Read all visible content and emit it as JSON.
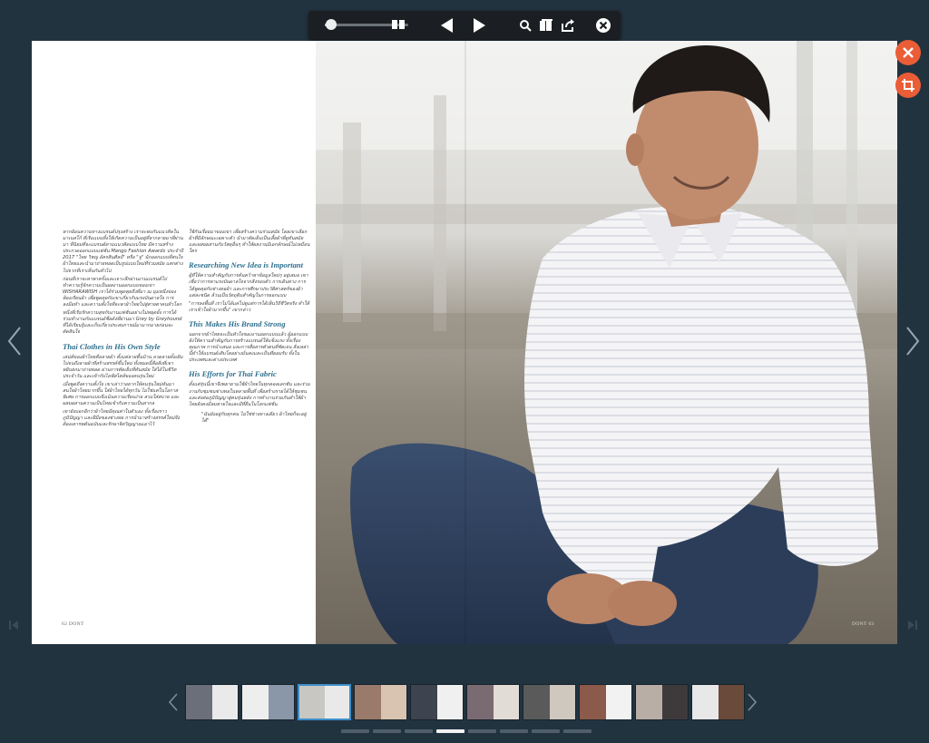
{
  "toolbar": {
    "zoom_level": 0.12,
    "icons": [
      "zoom-slider",
      "two-page-icon",
      "prev-icon",
      "next-icon",
      "search-icon",
      "thumbnails-icon",
      "share-icon",
      "close-icon"
    ]
  },
  "article": {
    "column_left": [
      "หากย้อนความทางแบรนด์ปรุงสร้าง เราจะพบกับแนวคิดใน มาเนสโก้ ที่เริ่มแบนทิ้งให้เกิดความเป็นอยู่ที่ลากลายมาที่ผ่านมา ที่นิยมที่จะแบรนด์ตามแนวคิดแบบไทย มีความสร้างประกวดออกแบบแฟชั่น Mango Fashion Awards ประจำปี 2017 \"ไทย วิชญู อัครสินศิลป์\" หรือ \"จู\" นักออกแบบที่สนใจผ้าไทยและนำมาถ่ายทอดเป็นรูปแบบใหม่ที่ร่วมสมัย แตกต่างไปจากที่เราเห็นกันทั่วไป",
      "ก่อนที่เราจะหาพาครั้งและเจาะลึกผ่านงานแบรนด์ไป ทำความรู้จักความเป็นผลงานออกแบบของเขา WISHARAWISH เราได้ร่วมพูดคุยถึงที่มา ณ มุมหนึ่งของห้องเรียนผ้า เพื่อพูดคุยกับเขาเกี่ยวกับแรงบันดาลใจ การลงมือทำ และความตั้งใจที่จะพาผ้าไทยไปสู่สายตาคนทั่วโลก",
      "หนึ่งที่เริ่มรักความสุขกับงานแฟชั่นอย่างไม่หยุดยั้ง การได้ร่วมทำงานกับแบรนด์ชื่อดังที่ผ่านมา Grey by Greyhound ที่ได้เรียนรู้และเก็บเกี่ยวประสบการณ์มามากมายก่อนจะตัดสินใจ"
    ],
    "subhead_1": "Thai Clothes in His Own Style",
    "column_left_2": [
      "เสน่ห์ของผ้าไทยคือลายผ้า ตั้งแต่ลายพื้นบ้าน ลวดลายดั้งเดิม ไปจนถึงลายผ้าที่สร้างสรรค์ขึ้นใหม่ ทั้งหมดนี้คือสิ่งที่เขาหยิบยกมาถ่ายทอด ผ่านการตัดเย็บที่ทันสมัย ใส่ได้ในชีวิตประจำวัน และเข้ากับไลฟ์สไตล์ของคนรุ่นใหม่",
      "เมื่อพูดถึงความตั้งใจ เขาเล่าว่าอยากให้คนรุ่นใหม่หันมาสนใจผ้าไทยมากขึ้น ใส่ผ้าไทยได้ทุกวัน ไม่ใช่แค่ในโอกาสพิเศษ การออกแบบจึงเน้นความเรียบง่าย สวมใส่สบาย และผสมผสานความเป็นไทยเข้ากับความเป็นสากล",
      "เขายังบอกอีกว่าผ้าไทยมีคุณค่าในตัวเอง ทั้งเรื่องราว ภูมิปัญญา และฝีมือของช่างทอ การนำมาสร้างสรรค์ใหม่จึงต้องเคารพต้นฉบับและรักษาจิตวิญญาณเอาไว้"
    ],
    "column_right": [
      "ใช้กันเรื่อยมาของเขา เพื่อสร้างความร่วมสมัย โดยเขาเลือกผ้าที่มีลักษณะเฉพาะตัว นำมาตัดเย็บเป็นเสื้อผ้าที่ดูทันสมัย และผสมผสานกับวัสดุอื่นๆ ทำให้ผลงานมีเอกลักษณ์ไม่เหมือนใคร"
    ],
    "subhead_2": "Researching New Idea is Important",
    "column_right_2": [
      "ผู้ที่ให้ความสำคัญกับการค้นคว้าหาข้อมูลใหม่ๆ อยู่เสมอ เขาเชื่อว่าการหาแรงบันดาลใจจากสิ่งรอบตัว การเดินทาง การได้พูดคุยกับช่างทอผ้า และการศึกษาประวัติศาสตร์ของผ้าแต่ละชนิด ล้วนเป็นวัตถุดิบสำคัญในการออกแบบ",
      "\"การลงพื้นที่ เราไม่ได้แค่ไปดูแต่การได้เห็นวิถีชีวิตจริง ทำให้เราเข้าใจผ้ามากขึ้น\" เขากล่าว"
    ],
    "subhead_3": "This Makes His Brand Strong",
    "column_right_3": [
      "นอกจากผ้าไทยจะเป็นหัวใจของงานออกแบบแล้ว ผู้ออกแบบยังให้ความสำคัญกับการสร้างแบรนด์ให้แข็งแรง ทั้งเรื่องคุณภาพ การนำเสนอ และการสื่อสารตัวตนที่ชัดเจน สิ่งเหล่านี้ทำให้แบรนด์เติบโตอย่างมั่นคงและเป็นที่ยอมรับ ทั้งในประเทศและต่างประเทศ"
    ],
    "subhead_4": "His Efforts for Thai Fabric",
    "column_right_4": [
      "ตั้งแต่รุ่นนี้เขาจึงพยายามใช้ผ้าไทยในทุกคอลเลกชัน และร่วมงานกับชุมชนช่างทอในหลายพื้นที่ เพื่อสร้างรายได้ให้ชุมชนและส่งต่อภูมิปัญญาสู่คนรุ่นหลัง การทำงานร่วมกันทำให้ผ้าไทยยังคงมีลมหายใจและมีที่ยืนในโลกแฟชั่น"
    ],
    "quote": "\"ฉันยังอยู่กับทุกคน ไม่ใช่ช่างทางเดียว ผ้าไทยก็จะอยู่ได้\"",
    "folio_left": "62 DONT",
    "folio_right": "DONT 63"
  },
  "thumbnails": {
    "count": 10,
    "active_index": 2,
    "colors": [
      [
        "#6b6f7a",
        "#eaeaea"
      ],
      [
        "#eeeeee",
        "#8a97a8"
      ],
      [
        "#c9c7c1",
        "#e9e9e9"
      ],
      [
        "#9a7a6a",
        "#d8c4b0"
      ],
      [
        "#3e4350",
        "#f0f0f0"
      ],
      [
        "#7a6a72",
        "#e2dcd6"
      ],
      [
        "#5a5a5a",
        "#cfc8bf"
      ],
      [
        "#8c5a4a",
        "#f2f2f2"
      ],
      [
        "#b8aea6",
        "#3e3a3c"
      ],
      [
        "#e8e8e8",
        "#6a4a3a"
      ]
    ]
  },
  "pager": {
    "count": 8,
    "active_index": 3
  }
}
